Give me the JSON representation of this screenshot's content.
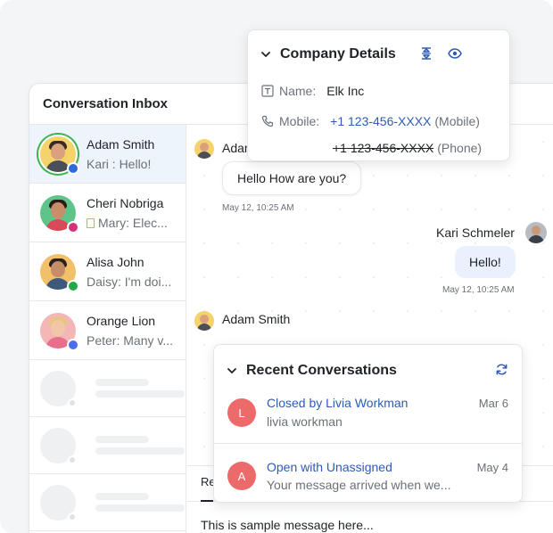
{
  "inbox": {
    "title": "Conversation Inbox"
  },
  "conversations": [
    {
      "name": "Adam Smith",
      "preview": "Kari : Hello!",
      "channel": "chat-icon",
      "channel_color": "#2e6bd9",
      "active": true
    },
    {
      "name": "Cheri Nobriga",
      "preview": "Mary: Elec...",
      "channel": "instagram-icon",
      "channel_color": "#d6307a",
      "preview_icon": "document-icon"
    },
    {
      "name": "Alisa John",
      "preview": "Daisy: I'm doi...",
      "channel": "whatsapp-icon",
      "channel_color": "#25a948"
    },
    {
      "name": "Orange Lion",
      "preview": "Peter: Many v...",
      "channel": "messenger-icon",
      "channel_color": "#4a6cf0"
    }
  ],
  "chat": {
    "messages": [
      {
        "sender": "Adam",
        "text": "Hello How are you?",
        "time": "May 12, 10:25 AM",
        "direction": "in"
      },
      {
        "sender": "Kari Schmeler",
        "text": "Hello!",
        "time": "May 12, 10:25 AM",
        "direction": "out"
      },
      {
        "sender": "Adam Smith",
        "text": "",
        "direction": "in"
      }
    ],
    "composer_tab": "Re",
    "composer_text": "This is sample message here..."
  },
  "company_details": {
    "title": "Company Details",
    "name_label": "Name:",
    "name_value": "Elk Inc",
    "mobile_label": "Mobile:",
    "mobile_number": "+1 123-456-XXXX",
    "mobile_type": "(Mobile)",
    "phone_number": "+1 123-456-XXXX",
    "phone_type": "(Phone)"
  },
  "recent_conversations": {
    "title": "Recent Conversations",
    "items": [
      {
        "initial": "L",
        "status": "Closed by Livia Workman",
        "subtitle": "livia workman",
        "date": "Mar 6"
      },
      {
        "initial": "A",
        "status": "Open with Unassigned",
        "subtitle": "Your message arrived when we...",
        "date": "May 4"
      }
    ]
  },
  "colors": {
    "accent_blue": "#2e5bb8",
    "avatar_red": "#ec6a6a",
    "active_ring": "#3fb34f",
    "active_bg": "#eef4fc",
    "outgoing_bubble": "#e8f1fd"
  }
}
